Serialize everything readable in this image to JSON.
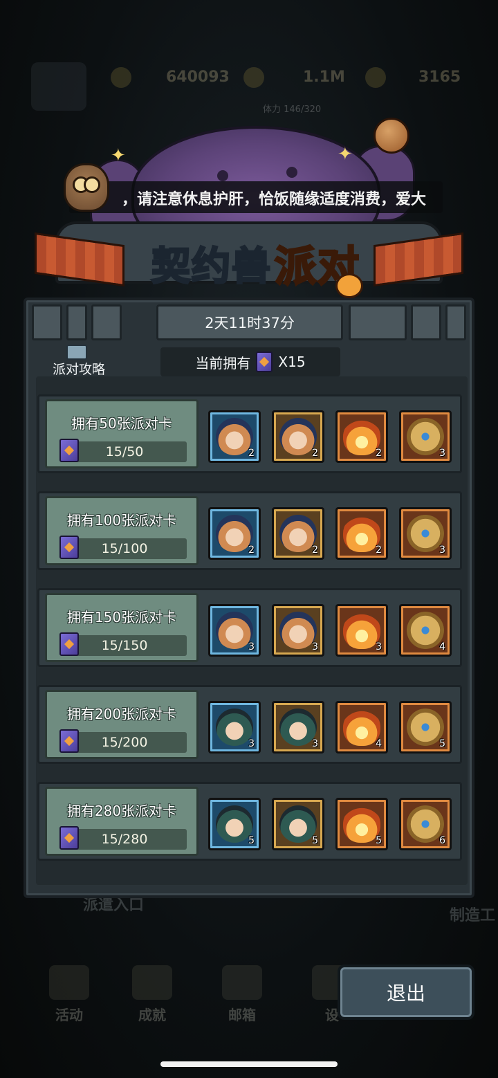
{
  "background": {
    "top_bar": {
      "resource_1": "640093",
      "resource_2": "1.1M",
      "resource_3": "3165",
      "progress_text": "体力 146/320"
    },
    "left_text": "派遣入口",
    "right_text": "制造工",
    "nav": [
      "活动",
      "成就",
      "邮箱",
      "设"
    ]
  },
  "notice": {
    "text": "，请注意休息护肝，恰饭随缘适度消费，爱大家"
  },
  "title": {
    "part1": "契约兽",
    "part2": "派对"
  },
  "timer": "2天11时37分",
  "strategy_label": "派对攻略",
  "owned": {
    "label": "当前拥有",
    "value": "X15"
  },
  "tiers": [
    {
      "title": "拥有50张派对卡",
      "progress": "15/50",
      "rewards": [
        {
          "type": "girl",
          "frame": "blue",
          "count": "2"
        },
        {
          "type": "girl",
          "frame": "gold",
          "count": "2"
        },
        {
          "type": "fire",
          "frame": "orange",
          "count": "2"
        },
        {
          "type": "vase",
          "frame": "orange",
          "count": "3"
        }
      ]
    },
    {
      "title": "拥有100张派对卡",
      "progress": "15/100",
      "rewards": [
        {
          "type": "girl",
          "frame": "blue",
          "count": "2"
        },
        {
          "type": "girl",
          "frame": "gold",
          "count": "2"
        },
        {
          "type": "fire",
          "frame": "orange",
          "count": "2"
        },
        {
          "type": "vase",
          "frame": "orange",
          "count": "3"
        }
      ]
    },
    {
      "title": "拥有150张派对卡",
      "progress": "15/150",
      "rewards": [
        {
          "type": "girl",
          "frame": "blue",
          "count": "3"
        },
        {
          "type": "girl",
          "frame": "gold",
          "count": "3"
        },
        {
          "type": "fire",
          "frame": "orange",
          "count": "3"
        },
        {
          "type": "vase",
          "frame": "orange",
          "count": "4"
        }
      ]
    },
    {
      "title": "拥有200张派对卡",
      "progress": "15/200",
      "rewards": [
        {
          "type": "boy",
          "frame": "blue",
          "count": "3"
        },
        {
          "type": "boy",
          "frame": "gold",
          "count": "3"
        },
        {
          "type": "fire",
          "frame": "orange",
          "count": "4"
        },
        {
          "type": "vase",
          "frame": "orange",
          "count": "5"
        }
      ]
    },
    {
      "title": "拥有280张派对卡",
      "progress": "15/280",
      "rewards": [
        {
          "type": "boy",
          "frame": "blue",
          "count": "5"
        },
        {
          "type": "boy",
          "frame": "gold",
          "count": "5"
        },
        {
          "type": "fire",
          "frame": "orange",
          "count": "5"
        },
        {
          "type": "vase",
          "frame": "orange",
          "count": "6"
        }
      ]
    }
  ],
  "exit_label": "退出"
}
